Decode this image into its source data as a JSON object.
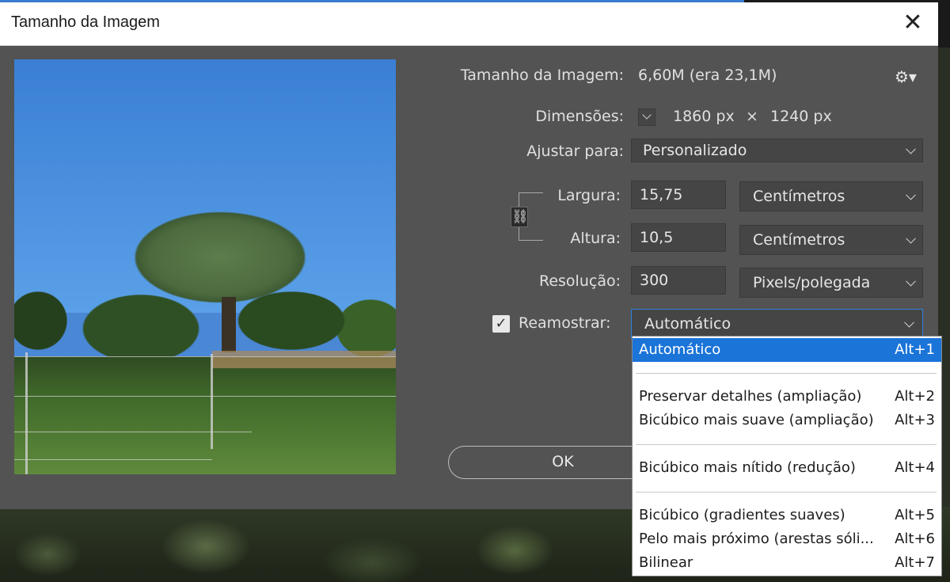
{
  "dialog": {
    "title": "Tamanho da Imagem",
    "close_label": "✕"
  },
  "info": {
    "size_label": "Tamanho da Imagem:",
    "size_value": "6,60M (era 23,1M)",
    "dimensions_label": "Dimensões:",
    "dimensions_width": "1860 px",
    "dimensions_sep": "×",
    "dimensions_height": "1240 px"
  },
  "fit": {
    "label": "Ajustar para:",
    "value": "Personalizado"
  },
  "width": {
    "label": "Largura:",
    "value": "15,75",
    "unit": "Centímetros"
  },
  "height": {
    "label": "Altura:",
    "value": "10,5",
    "unit": "Centímetros"
  },
  "resolution": {
    "label": "Resolução:",
    "value": "300",
    "unit": "Pixels/polegada"
  },
  "resample": {
    "label": "Reamostrar:",
    "checked": true,
    "value": "Automático",
    "options": [
      {
        "name": "Automático",
        "key": "Alt+1"
      },
      {
        "name": "Preservar detalhes (ampliação)",
        "key": "Alt+2"
      },
      {
        "name": "Bicúbico mais suave (ampliação)",
        "key": "Alt+3"
      },
      {
        "name": "Bicúbico mais nítido (redução)",
        "key": "Alt+4"
      },
      {
        "name": "Bicúbico (gradientes suaves)",
        "key": "Alt+5"
      },
      {
        "name": "Pelo mais próximo (arestas sóli...",
        "key": "Alt+6"
      },
      {
        "name": "Bilinear",
        "key": "Alt+7"
      }
    ]
  },
  "buttons": {
    "ok": "OK"
  },
  "colors": {
    "dialog_bg": "#535353",
    "accent": "#1b74d8"
  }
}
